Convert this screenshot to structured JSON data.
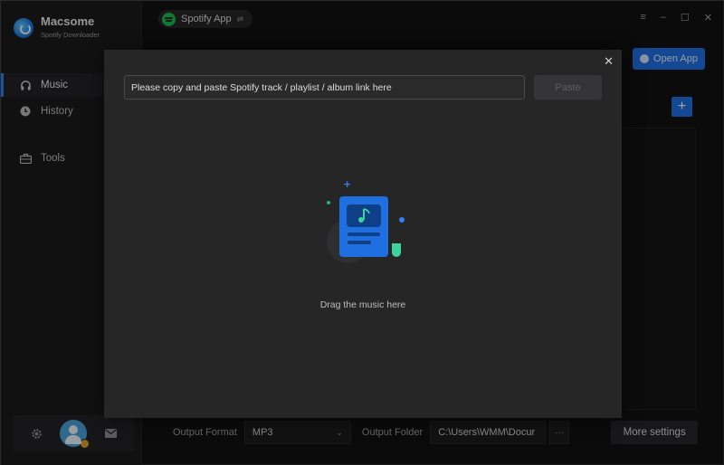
{
  "brand": {
    "title": "Macsome",
    "subtitle": "Spotify Downloader"
  },
  "nav": {
    "items": [
      {
        "label": "Music",
        "icon": "headphones-icon",
        "active": true
      },
      {
        "label": "History",
        "icon": "clock-icon",
        "active": false
      },
      {
        "label": "Tools",
        "icon": "toolbox-icon",
        "active": false
      }
    ]
  },
  "topbar": {
    "source_label": "Spotify App",
    "swap_icon": "⇌"
  },
  "open_app": {
    "label": "Open App"
  },
  "bottom": {
    "output_format_label": "Output Format",
    "output_format_value": "MP3",
    "output_folder_label": "Output Folder",
    "output_folder_value": "C:\\Users\\WMM\\Docur",
    "browse_label": "···",
    "more_settings_label": "More settings"
  },
  "modal": {
    "url_placeholder": "Please copy and paste Spotify track / playlist / album link here",
    "paste_label": "Paste",
    "drag_text": "Drag the music here"
  },
  "colors": {
    "accent": "#1f6fe0",
    "spotify": "#1db954"
  }
}
